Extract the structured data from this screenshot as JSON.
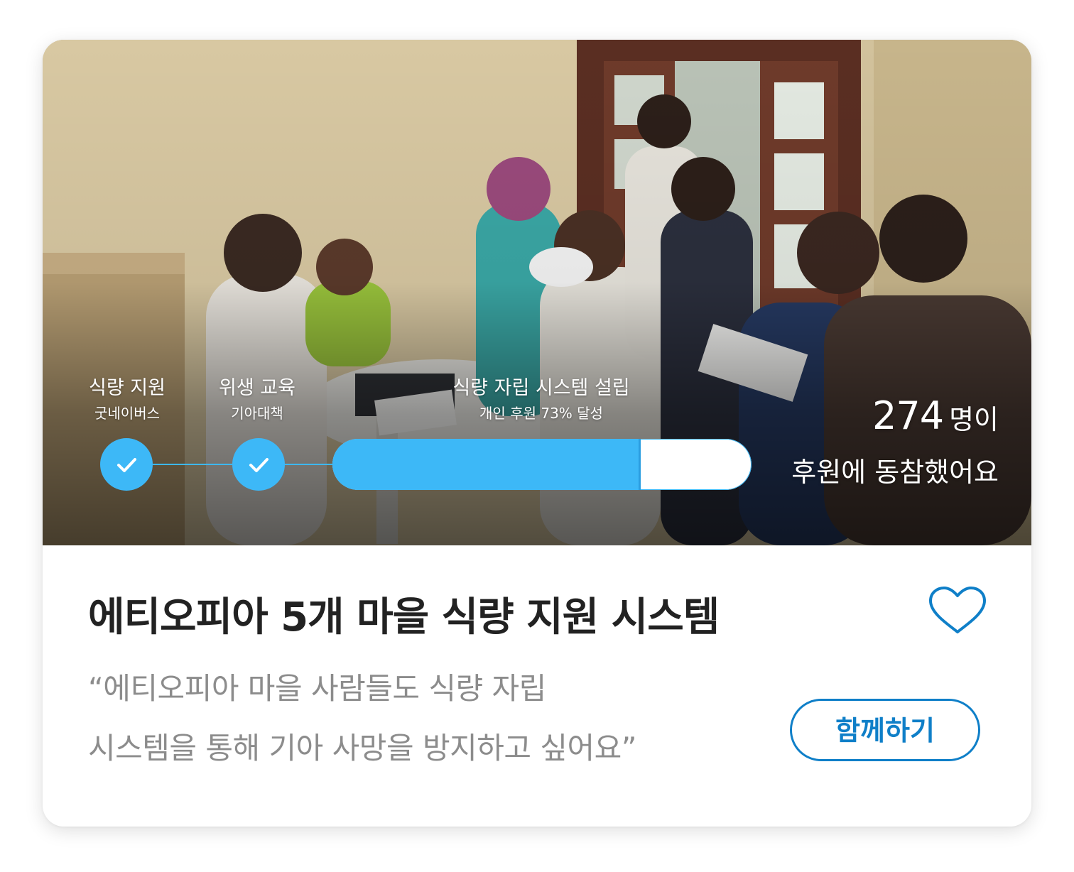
{
  "card": {
    "steps": [
      {
        "title": "식량 지원",
        "sub": "굿네이버스",
        "completed": true
      },
      {
        "title": "위생 교육",
        "sub": "기아대책",
        "completed": true
      },
      {
        "title": "식량 자립 시스템 설립",
        "sub": "개인 후원 73% 달성",
        "completed": false,
        "progress_percent": 73
      }
    ],
    "supporters": {
      "count": "274",
      "unit": "명이",
      "text": "후원에 동참했어요"
    },
    "title": "에티오피아 5개 마을 식량 지원 시스템",
    "quote_lines": [
      "“에티오피아 마을 사람들도 식량 자립",
      "시스템을 통해 기아 사망을 방지하고 싶어요”"
    ],
    "join_button_label": "함께하기",
    "icons": {
      "like": "heart-outline-icon",
      "step_done": "check-icon"
    },
    "colors": {
      "accent": "#3db8f7",
      "button": "#0f7fc8",
      "title": "#222222",
      "quote": "#8c8c8c"
    }
  }
}
